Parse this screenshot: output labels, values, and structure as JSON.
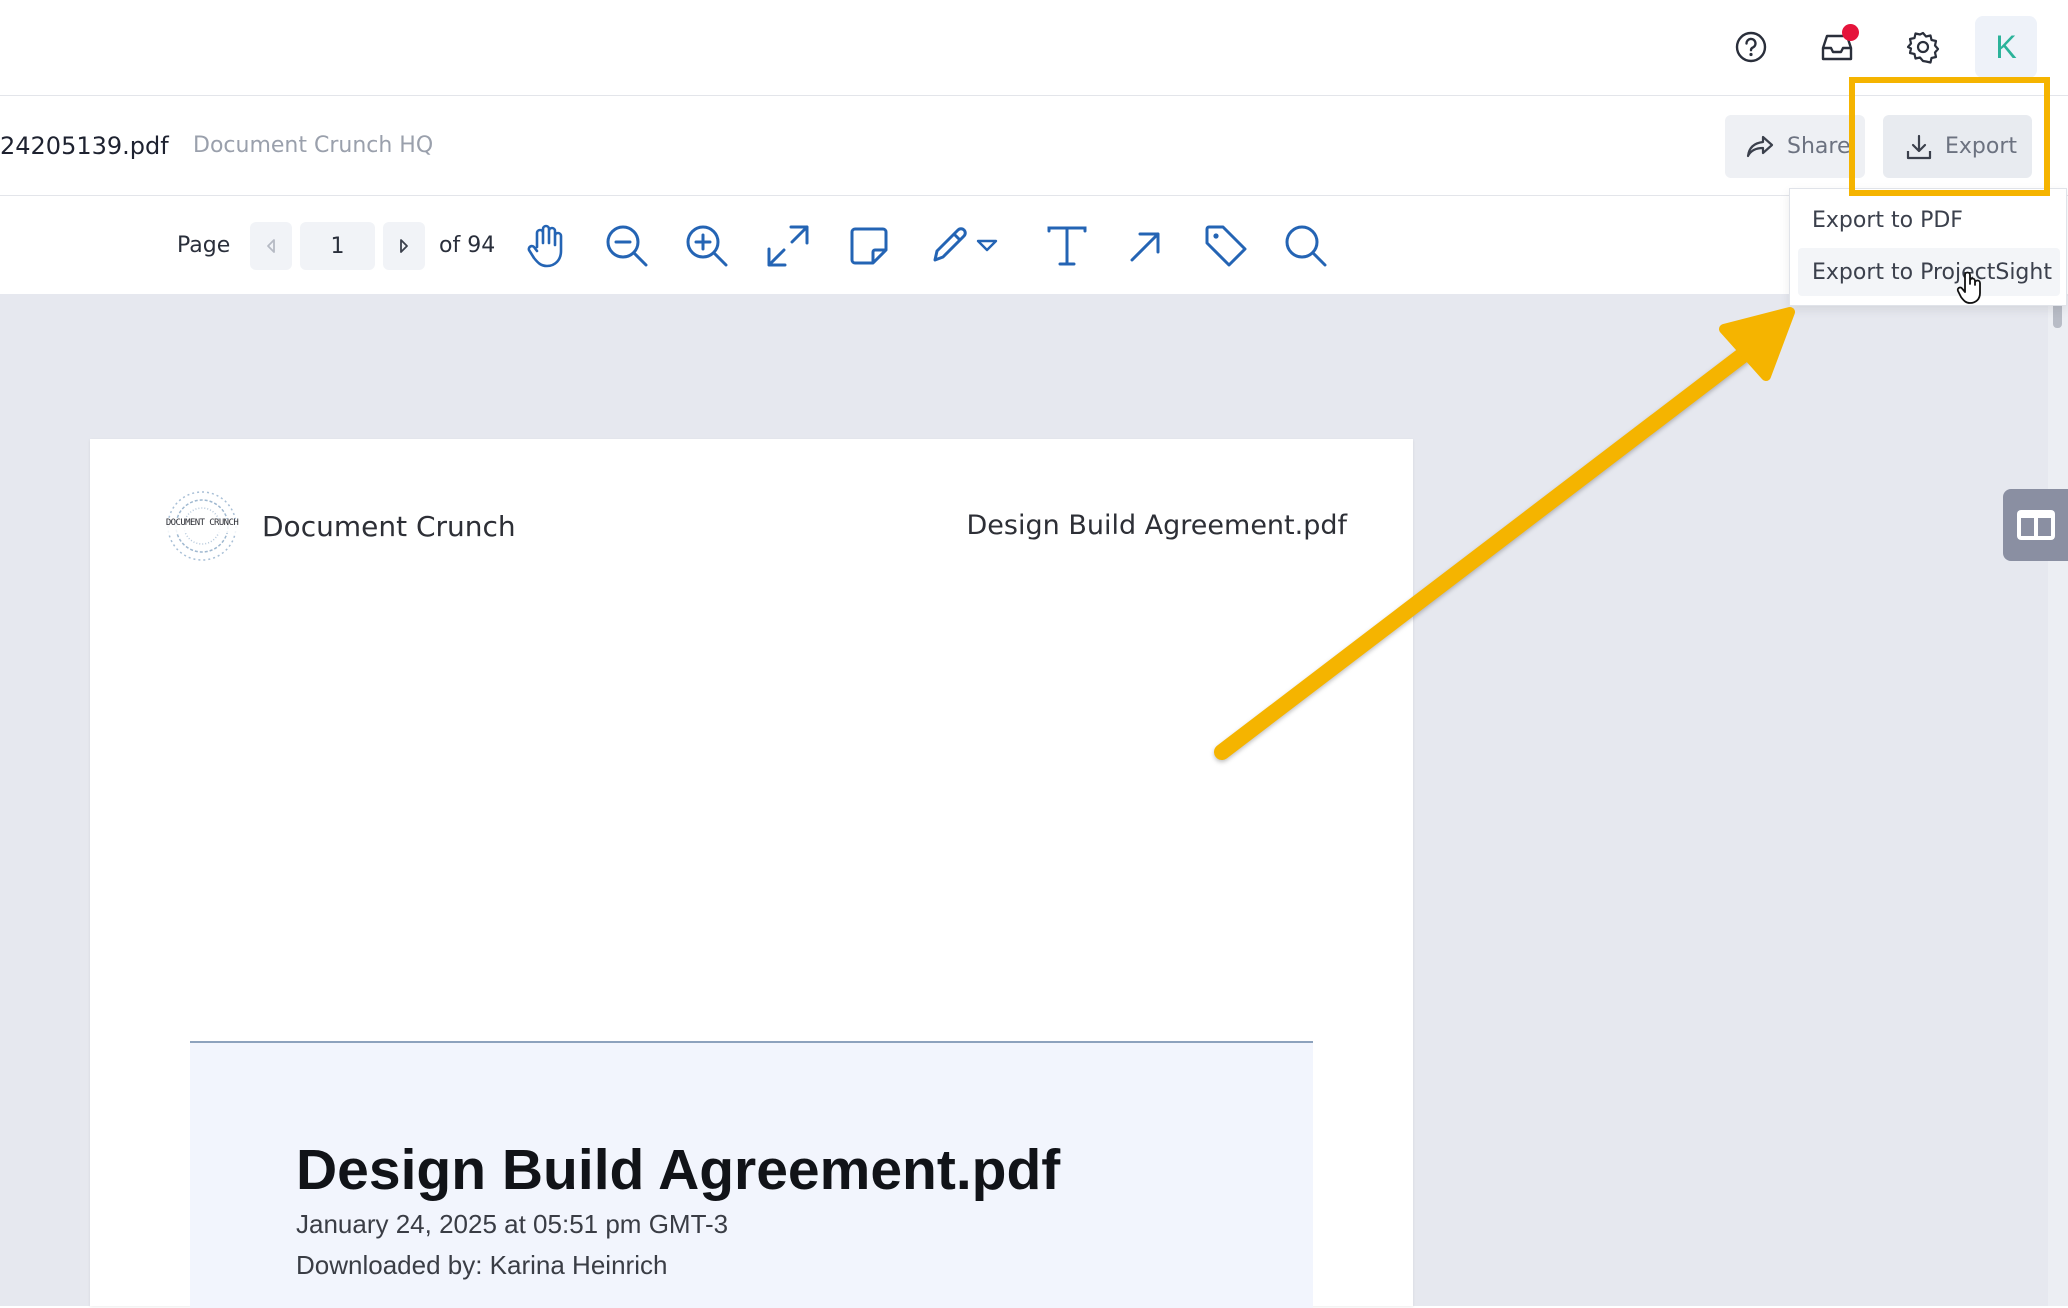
{
  "header": {
    "icons": [
      "help-icon",
      "inbox-icon",
      "settings-icon"
    ],
    "avatar_initial": "K",
    "notification_color": "#e5143b"
  },
  "document": {
    "file_name": "24205139.pdf",
    "organization": "Document Crunch HQ",
    "share_label": "Share",
    "export_label": "Export"
  },
  "export_menu": {
    "items": [
      {
        "label": "Export to PDF"
      },
      {
        "label": "Export to ProjectSight"
      }
    ],
    "hovered_index": 1
  },
  "toolbar": {
    "page_label": "Page",
    "current_page": "1",
    "total_pages_label": "of 94",
    "tools": [
      "pan-hand-icon",
      "zoom-out-icon",
      "zoom-in-icon",
      "fit-expand-icon",
      "sticky-note-icon",
      "pen-icon",
      "pen-dropdown-icon",
      "text-icon",
      "arrow-tool-icon",
      "tag-icon",
      "search-icon"
    ]
  },
  "pdf": {
    "brand_name": "Document Crunch",
    "logo_text": "DOCUMENT CRUNCH",
    "header_file": "Design Build Agreement.pdf",
    "cover_title": "Design Build Agreement.pdf",
    "cover_date": "January 24, 2025 at 05:51 pm GMT-3",
    "downloaded_by": "Downloaded by: Karina Heinrich"
  },
  "annotation": {
    "highlight_color": "#f5b400",
    "accent_blue": "#2464b4"
  }
}
